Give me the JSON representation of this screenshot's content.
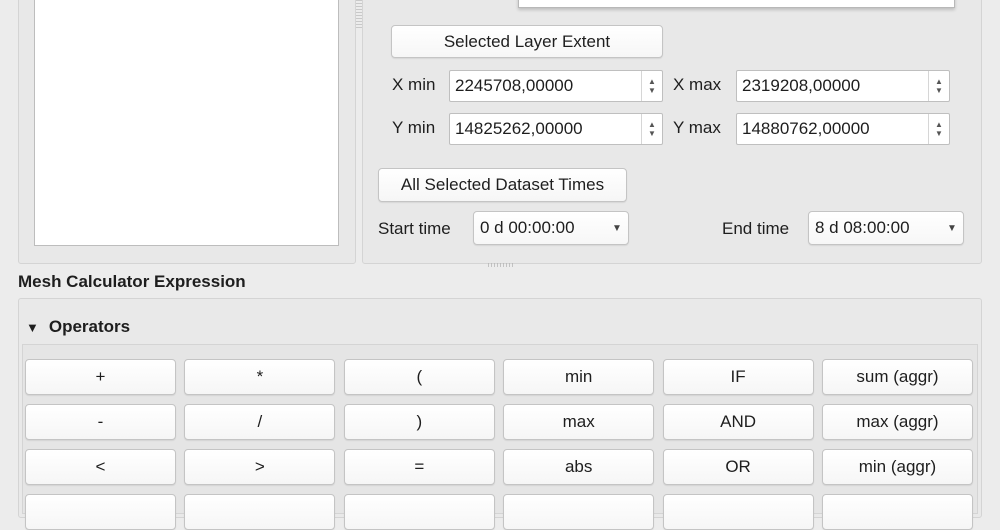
{
  "extent": {
    "selected_layer_extent_label": "Selected Layer Extent",
    "x_min_label": "X min",
    "x_min_value": "2245708,00000",
    "x_max_label": "X max",
    "x_max_value": "2319208,00000",
    "y_min_label": "Y min",
    "y_min_value": "14825262,00000",
    "y_max_label": "Y max",
    "y_max_value": "14880762,00000"
  },
  "time": {
    "all_selected_dataset_times_label": "All Selected Dataset Times",
    "start_time_label": "Start time",
    "start_time_value": "0 d 00:00:00",
    "end_time_label": "End time",
    "end_time_value": "8 d 08:00:00"
  },
  "expression": {
    "title": "Mesh Calculator Expression",
    "operators_label": "Operators"
  },
  "operators": [
    [
      "+",
      "*",
      "(",
      "min",
      "IF",
      "sum (aggr)"
    ],
    [
      "-",
      "/",
      ")",
      "max",
      "AND",
      "max (aggr)"
    ],
    [
      "<",
      ">",
      "=",
      "abs",
      "OR",
      "min (aggr)"
    ],
    [
      "",
      "",
      "",
      "",
      "",
      ""
    ]
  ],
  "icons": {
    "spin_up": "▲",
    "spin_down": "▼",
    "combo_caret": "▼",
    "collapse": "▼"
  }
}
